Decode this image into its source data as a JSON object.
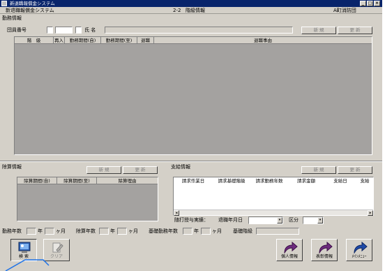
{
  "window": {
    "title": "新退職報償金システム",
    "system_name": "新退職報償金システム",
    "screen_code": "2-2",
    "screen_name": "階級情報",
    "department": "A町消防団"
  },
  "kinmu": {
    "section_label": "勤務情報",
    "member_no_label": "団員番号",
    "name_label": "氏 名",
    "new_button": "新 規",
    "update_button": "更 新",
    "columns": [
      "階　級",
      "再入",
      "勤務期間(自)",
      "勤務期間(至)",
      "退職",
      "退職事由"
    ]
  },
  "jogai": {
    "section_label": "除算情報",
    "new_button": "新 規",
    "update_button": "更 新",
    "columns": [
      "除算期間(自)",
      "除算期間(至)",
      "除算理由"
    ]
  },
  "shikyu": {
    "section_label": "支給情報",
    "new_button": "新 規",
    "update_button": "更 新",
    "columns": [
      "請求作業日",
      "請求基礎階級",
      "請求勤務年数",
      "請求金額",
      "支給日",
      "支給"
    ],
    "jisseki_label": "随打授与実績：",
    "taishoku_date_label": "退職年月日",
    "kubun_label": "区分"
  },
  "summary": {
    "kinmu_nensu_label": "勤務年数",
    "year_unit": "年",
    "month_unit": "ヶ月",
    "jogai_nensu_label": "除算年数",
    "kiso_nensu_label": "基礎勤務年数",
    "kiso_kaikyu_label": "基礎階級"
  },
  "buttons": {
    "search": "検 索",
    "clear": "クリア",
    "personal": "個人情報",
    "commendation": "表彰情報",
    "main_menu": "ﾒｲﾝﾒﾆｭｰ"
  },
  "colors": {
    "titlebar": "#08246b",
    "grid_empty": "#a4a2a0",
    "face": "#d4d0c8",
    "arrow_icon": "#6e2b7e"
  }
}
